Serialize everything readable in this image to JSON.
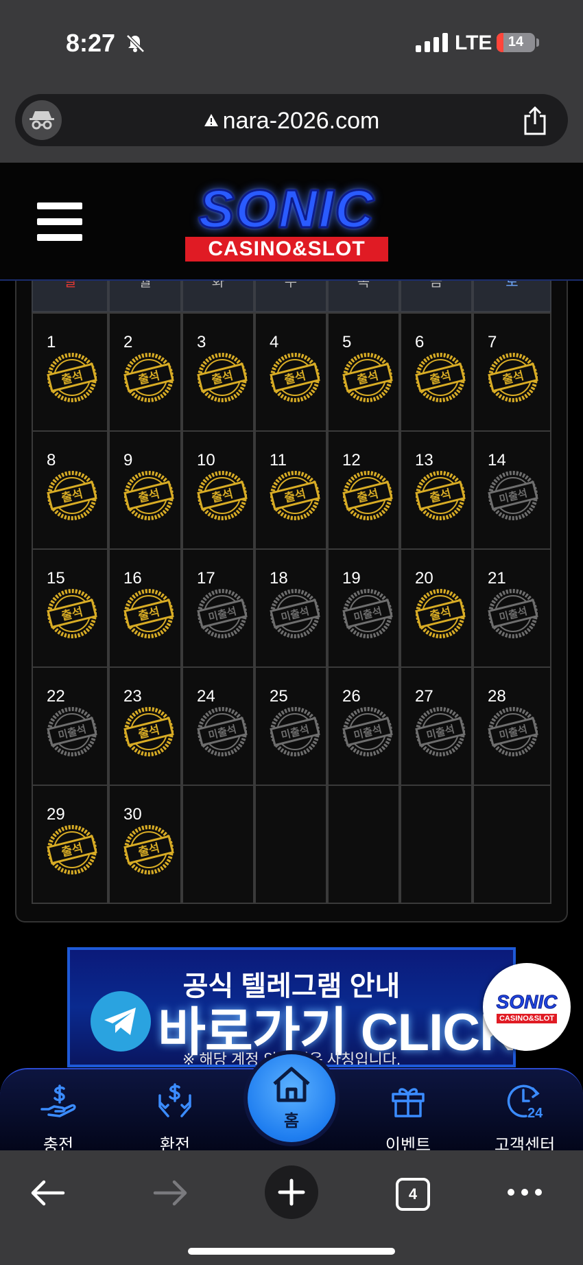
{
  "status_bar": {
    "time": "8:27",
    "network": "LTE",
    "battery": "14"
  },
  "browser": {
    "url": "nara-2026.com",
    "tab_count": "4"
  },
  "site": {
    "logo_main": "SONIC",
    "logo_sub": "CASINO&SLOT"
  },
  "calendar": {
    "weekdays": [
      "일",
      "월",
      "화",
      "수",
      "목",
      "금",
      "토"
    ],
    "stamp_present": "출석",
    "stamp_absent": "미출석",
    "days": [
      {
        "day": "1",
        "attended": true
      },
      {
        "day": "2",
        "attended": true
      },
      {
        "day": "3",
        "attended": true
      },
      {
        "day": "4",
        "attended": true
      },
      {
        "day": "5",
        "attended": true
      },
      {
        "day": "6",
        "attended": true
      },
      {
        "day": "7",
        "attended": true
      },
      {
        "day": "8",
        "attended": true
      },
      {
        "day": "9",
        "attended": true
      },
      {
        "day": "10",
        "attended": true
      },
      {
        "day": "11",
        "attended": true
      },
      {
        "day": "12",
        "attended": true
      },
      {
        "day": "13",
        "attended": true
      },
      {
        "day": "14",
        "attended": false
      },
      {
        "day": "15",
        "attended": true
      },
      {
        "day": "16",
        "attended": true
      },
      {
        "day": "17",
        "attended": false
      },
      {
        "day": "18",
        "attended": false
      },
      {
        "day": "19",
        "attended": false
      },
      {
        "day": "20",
        "attended": true
      },
      {
        "day": "21",
        "attended": false
      },
      {
        "day": "22",
        "attended": false
      },
      {
        "day": "23",
        "attended": true
      },
      {
        "day": "24",
        "attended": false
      },
      {
        "day": "25",
        "attended": false
      },
      {
        "day": "26",
        "attended": false
      },
      {
        "day": "27",
        "attended": false
      },
      {
        "day": "28",
        "attended": false
      },
      {
        "day": "29",
        "attended": true
      },
      {
        "day": "30",
        "attended": true
      }
    ],
    "empty_cells": 5
  },
  "banner": {
    "title": "공식 텔레그램 안내",
    "cta": "바로가기 CLICK",
    "note": "※ 해당 계정 외 사칭은 사칭입니다."
  },
  "floating_logo": {
    "main": "SONIC",
    "sub": "CASINO&SLOT"
  },
  "bottom_nav": {
    "items": [
      {
        "label": "충전",
        "icon": "deposit-icon"
      },
      {
        "label": "환전",
        "icon": "withdraw-icon"
      },
      {
        "label": "홈",
        "icon": "home-icon"
      },
      {
        "label": "이벤트",
        "icon": "gift-icon"
      },
      {
        "label": "고객센터",
        "icon": "support-24-icon"
      }
    ]
  },
  "colors": {
    "stamp_gold": "#d8ac25",
    "stamp_grey": "#6e6e6e",
    "nav_icon_blue": "#3b8cff",
    "accent_blue": "#2a5bff",
    "logo_red": "#e01b24"
  }
}
